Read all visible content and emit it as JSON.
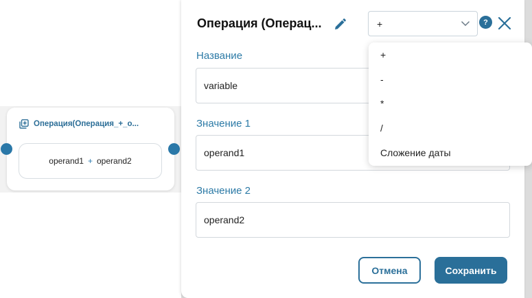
{
  "node": {
    "title": "Операция(Операция_+_о...",
    "operand_left": "operand1",
    "operator": "+",
    "operand_right": "operand2"
  },
  "dialog": {
    "title": "Операция (Операц...",
    "operation_select": {
      "value": "+"
    },
    "help_label": "?",
    "fields": {
      "name": {
        "label": "Название",
        "value": "variable"
      },
      "value1": {
        "label": "Значение 1",
        "value": "operand1"
      },
      "value2": {
        "label": "Значение 2",
        "value": "operand2"
      }
    },
    "cancel_label": "Отмена",
    "save_label": "Сохранить"
  },
  "dropdown": {
    "options": [
      "+",
      "-",
      "*",
      "/",
      "Сложение даты"
    ]
  },
  "colors": {
    "accent": "#2a6f99",
    "label": "#2c7aa6",
    "node_title": "#2c6e97"
  }
}
